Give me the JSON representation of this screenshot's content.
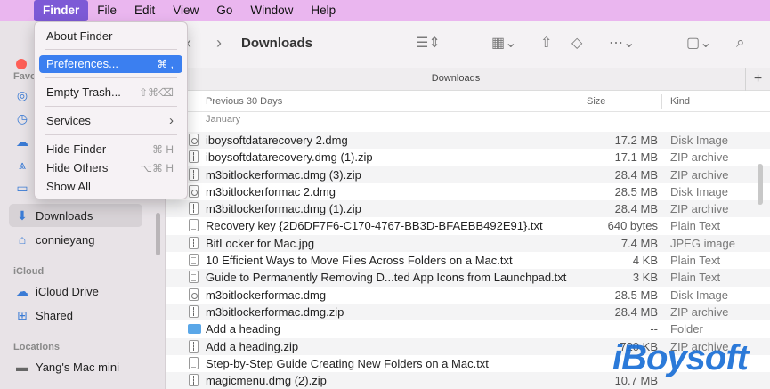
{
  "menubar": {
    "apple_glyph": "",
    "items": [
      "Finder",
      "File",
      "Edit",
      "View",
      "Go",
      "Window",
      "Help"
    ]
  },
  "dropdown": {
    "items": [
      {
        "label": "About Finder",
        "shortcut": ""
      },
      {
        "label": "Preferences...",
        "shortcut": "⌘ ,"
      },
      {
        "label": "Empty Trash...",
        "shortcut": "⇧⌘⌫"
      },
      {
        "label": "Services",
        "shortcut": "›"
      },
      {
        "label": "Hide Finder",
        "shortcut": "⌘ H"
      },
      {
        "label": "Hide Others",
        "shortcut": "⌥⌘ H"
      },
      {
        "label": "Show All",
        "shortcut": ""
      }
    ]
  },
  "sidebar": {
    "favorites_label": "Favo",
    "icloud_label": "iCloud",
    "locations_label": "Locations",
    "items": {
      "downloads": "Downloads",
      "connieyang": "connieyang",
      "icloud_drive": "iCloud Drive",
      "shared": "Shared",
      "mac_mini": "Yang's Mac mini"
    }
  },
  "toolbar": {
    "title": "Downloads",
    "back": "‹",
    "forward": "›"
  },
  "pathbar": {
    "label": "Downloads",
    "add": "+"
  },
  "columns": {
    "name": "Previous 30 Days",
    "size": "Size",
    "kind": "Kind"
  },
  "group_label": "January",
  "files": [
    {
      "name": "iboysoftdatarecovery 2.dmg",
      "size": "17.2 MB",
      "kind": "Disk Image",
      "icon": "dmg"
    },
    {
      "name": "iboysoftdatarecovery.dmg (1).zip",
      "size": "17.1 MB",
      "kind": "ZIP archive",
      "icon": "zip"
    },
    {
      "name": "m3bitlockerformac.dmg (3).zip",
      "size": "28.4 MB",
      "kind": "ZIP archive",
      "icon": "zip"
    },
    {
      "name": "m3bitlockerformac 2.dmg",
      "size": "28.5 MB",
      "kind": "Disk Image",
      "icon": "dmg"
    },
    {
      "name": "m3bitlockerformac.dmg (1).zip",
      "size": "28.4 MB",
      "kind": "ZIP archive",
      "icon": "zip"
    },
    {
      "name": "Recovery key {2D6DF7F6-C170-4767-BB3D-BFAEBB492E91}.txt",
      "size": "640 bytes",
      "kind": "Plain Text",
      "icon": "txt"
    },
    {
      "name": "BitLocker for Mac.jpg",
      "size": "7.4 MB",
      "kind": "JPEG image",
      "icon": "zip"
    },
    {
      "name": "10 Efficient Ways to Move Files Across Folders on a Mac.txt",
      "size": "4 KB",
      "kind": "Plain Text",
      "icon": "txt"
    },
    {
      "name": "Guide to Permanently Removing D...ted App Icons from Launchpad.txt",
      "size": "3 KB",
      "kind": "Plain Text",
      "icon": "txt"
    },
    {
      "name": "m3bitlockerformac.dmg",
      "size": "28.5 MB",
      "kind": "Disk Image",
      "icon": "dmg"
    },
    {
      "name": "m3bitlockerformac.dmg.zip",
      "size": "28.4 MB",
      "kind": "ZIP archive",
      "icon": "zip"
    },
    {
      "name": "Add a heading",
      "size": "--",
      "kind": "Folder",
      "icon": "folder"
    },
    {
      "name": "Add a heading.zip",
      "size": "720 KB",
      "kind": "ZIP archive",
      "icon": "zip"
    },
    {
      "name": "Step-by-Step Guide Creating New Folders on a Mac.txt",
      "size": "",
      "kind": "",
      "icon": "txt"
    },
    {
      "name": "magicmenu.dmg (2).zip",
      "size": "10.7 MB",
      "kind": "",
      "icon": "zip"
    }
  ],
  "watermark": "iBoysoft",
  "colors": {
    "menubar": "#eab6ef",
    "menu_active": "#7d5ad6",
    "highlight": "#3b7ff0",
    "accent_icon": "#3a7bd5",
    "close_button": "#fe5f57"
  }
}
